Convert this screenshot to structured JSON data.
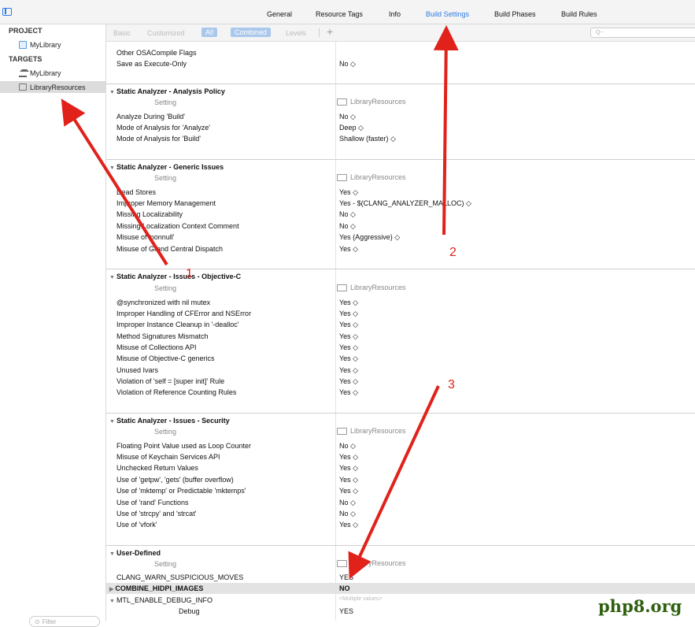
{
  "tabs": [
    "General",
    "Resource Tags",
    "Info",
    "Build Settings",
    "Build Phases",
    "Build Rules"
  ],
  "active_tab": "Build Settings",
  "sidebar": {
    "project_header": "PROJECT",
    "project_item": "MyLibrary",
    "targets_header": "TARGETS",
    "targets": [
      "MyLibrary",
      "LibraryResources"
    ],
    "selected_target": "LibraryResources",
    "filter_placeholder": "Filter"
  },
  "filterbar": {
    "items": [
      "Basic",
      "Customized",
      "All",
      "Combined",
      "Levels"
    ],
    "selected": [
      "All",
      "Combined"
    ],
    "add": "+",
    "search_placeholder": "Q~"
  },
  "column_headers": {
    "setting": "Setting",
    "target": "LibraryResources"
  },
  "top_rows": [
    {
      "label": "Other OSACompile Flags",
      "value": ""
    },
    {
      "label": "Save as Execute-Only",
      "value": "No ◇"
    }
  ],
  "sections": [
    {
      "title": "Static Analyzer - Analysis Policy",
      "rows": [
        {
          "label": "Analyze During 'Build'",
          "value": "No ◇"
        },
        {
          "label": "Mode of Analysis for 'Analyze'",
          "value": "Deep ◇"
        },
        {
          "label": "Mode of Analysis for 'Build'",
          "value": "Shallow (faster) ◇"
        }
      ]
    },
    {
      "title": "Static Analyzer - Generic Issues",
      "rows": [
        {
          "label": "Dead Stores",
          "value": "Yes ◇"
        },
        {
          "label": "Improper Memory Management",
          "value": "Yes  -  $(CLANG_ANALYZER_MALLOC) ◇"
        },
        {
          "label": "Missing Localizability",
          "value": "No ◇"
        },
        {
          "label": "Missing Localization Context Comment",
          "value": "No ◇"
        },
        {
          "label": "Misuse of 'nonnull'",
          "value": "Yes (Aggressive) ◇"
        },
        {
          "label": "Misuse of Grand Central Dispatch",
          "value": "Yes ◇"
        }
      ]
    },
    {
      "title": "Static Analyzer - Issues - Objective-C",
      "rows": [
        {
          "label": "@synchronized with nil mutex",
          "value": "Yes ◇"
        },
        {
          "label": "Improper Handling of CFError and NSError",
          "value": "Yes ◇"
        },
        {
          "label": "Improper Instance Cleanup in '-dealloc'",
          "value": "Yes ◇"
        },
        {
          "label": "Method Signatures Mismatch",
          "value": "Yes ◇"
        },
        {
          "label": "Misuse of Collections API",
          "value": "Yes ◇"
        },
        {
          "label": "Misuse of Objective-C generics",
          "value": "Yes ◇"
        },
        {
          "label": "Unused Ivars",
          "value": "Yes ◇"
        },
        {
          "label": "Violation of 'self = [super init]' Rule",
          "value": "Yes ◇"
        },
        {
          "label": "Violation of Reference Counting Rules",
          "value": "Yes ◇"
        }
      ]
    },
    {
      "title": "Static Analyzer - Issues - Security",
      "rows": [
        {
          "label": "Floating Point Value used as Loop Counter",
          "value": "No ◇"
        },
        {
          "label": "Misuse of Keychain Services API",
          "value": "Yes ◇"
        },
        {
          "label": "Unchecked Return Values",
          "value": "Yes ◇"
        },
        {
          "label": "Use of 'getpw', 'gets' (buffer overflow)",
          "value": "Yes ◇"
        },
        {
          "label": "Use of 'mktemp' or Predictable 'mktemps'",
          "value": "Yes ◇"
        },
        {
          "label": "Use of 'rand' Functions",
          "value": "No ◇"
        },
        {
          "label": "Use of 'strcpy' and 'strcat'",
          "value": "No ◇"
        },
        {
          "label": "Use of 'vfork'",
          "value": "Yes ◇"
        }
      ]
    }
  ],
  "user_defined": {
    "title": "User-Defined",
    "rows": [
      {
        "label": "CLANG_WARN_SUSPICIOUS_MOVES",
        "value": "YES"
      },
      {
        "label": "COMBINE_HIDPI_IMAGES",
        "value": "NO"
      },
      {
        "label": "MTL_ENABLE_DEBUG_INFO",
        "value": "<Multiple values>"
      },
      {
        "label": "Debug",
        "value": "YES"
      }
    ]
  },
  "annotations": [
    "1",
    "2",
    "3"
  ],
  "annotation_color": "#e0221b",
  "accent_color": "#2c7be5",
  "watermark": "php8.org"
}
